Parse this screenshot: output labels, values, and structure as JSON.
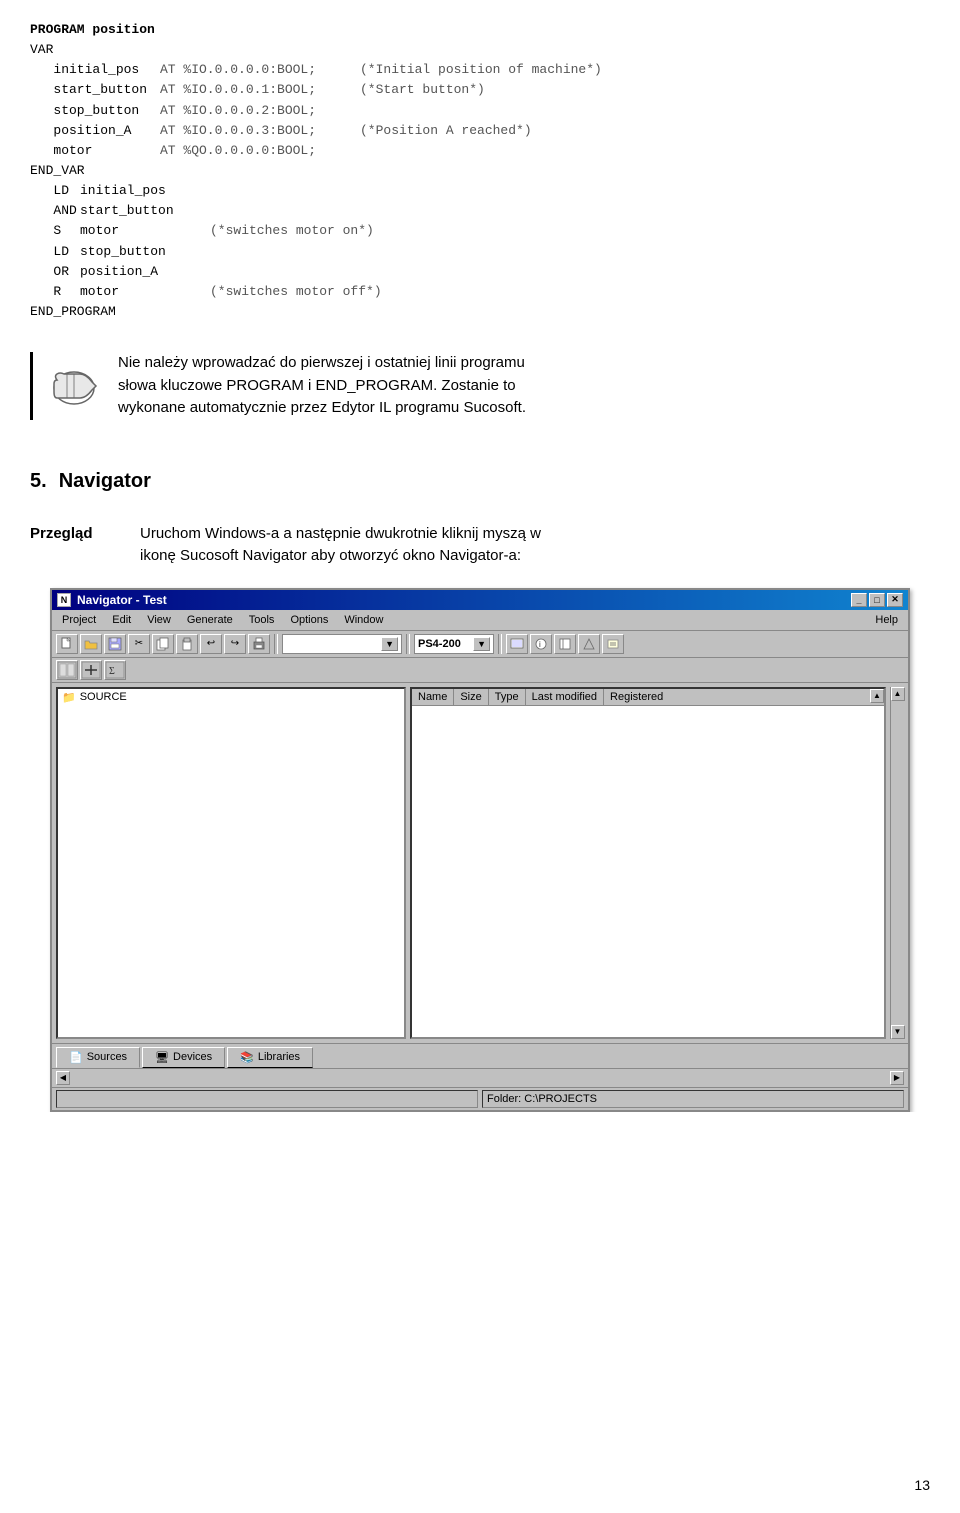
{
  "code": {
    "title": "PROGRAM position",
    "var_start": "VAR",
    "var_end": "END_VAR",
    "end_program": "END_PROGRAM",
    "variables": [
      {
        "name": "initial_pos",
        "addr": "AT %IO.0.0.0.0:BOOL;",
        "comment": "(*Initial position of machine*)"
      },
      {
        "name": "start_button",
        "addr": "AT %IO.0.0.0.1:BOOL;",
        "comment": "(*Start button*)"
      },
      {
        "name": "stop_button",
        "addr": "AT %IO.0.0.0.2:BOOL;",
        "comment": ""
      },
      {
        "name": "position_A",
        "addr": "AT %IO.0.0.0.3:BOOL;",
        "comment": "(*Position A reached*)"
      },
      {
        "name": "motor",
        "addr": "AT %QO.0.0.0.0:BOOL;",
        "comment": ""
      }
    ],
    "instructions": [
      {
        "op": "LD",
        "operand": "initial_pos",
        "comment": ""
      },
      {
        "op": "AND",
        "operand": "start_button",
        "comment": ""
      },
      {
        "op": "S",
        "operand": "motor",
        "comment": "(*switches motor on*)"
      },
      {
        "op": "LD",
        "operand": "stop_button",
        "comment": ""
      },
      {
        "op": "OR",
        "operand": "position_A",
        "comment": ""
      },
      {
        "op": "R",
        "operand": "motor",
        "comment": "(*switches motor off*)"
      }
    ]
  },
  "note": {
    "text_line1": "Nie należy wprowadzać do pierwszej i ostatniej linii programu",
    "text_line2": "słowa kluczowe PROGRAM i END_PROGRAM. Zostanie to",
    "text_line3": "wykonane automatycznie przez Edytor IL programu Sucosoft."
  },
  "section": {
    "number": "5.",
    "title": "Navigator"
  },
  "przeglad": {
    "label": "Przegląd",
    "text_line1": "Uruchom Windows-a a następnie dwukrotnie kliknij myszą w",
    "text_line2": "ikonę Sucosoft Navigator aby otworzyć okno Navigator-a:"
  },
  "window": {
    "title": "Navigator - Test",
    "title_icon": "N",
    "controls": [
      "_",
      "□",
      "✕"
    ],
    "menubar": [
      "Project",
      "Edit",
      "View",
      "Generate",
      "Tools",
      "Options",
      "Window",
      "Help"
    ],
    "toolbar1_buttons": [
      "□",
      "📂",
      "💾",
      "✂",
      "📋",
      "📋",
      "↩",
      "↪",
      "🖨"
    ],
    "dropdown1": "",
    "dropdown2": "PS4-200",
    "toolbar2_buttons": [
      "▶",
      "⏹",
      "⏹"
    ],
    "tree_item": "SOURCE",
    "panel_columns": [
      "Name",
      "Size",
      "Type",
      "Last modified",
      "Registered"
    ],
    "tabs": [
      {
        "label": "Sources",
        "icon": "📄"
      },
      {
        "label": "Devices",
        "icon": "🖥"
      },
      {
        "label": "Libraries",
        "icon": "📚"
      }
    ],
    "active_tab": 0,
    "statusbar": "Folder: C:\\PROJECTS"
  },
  "page_number": "13"
}
